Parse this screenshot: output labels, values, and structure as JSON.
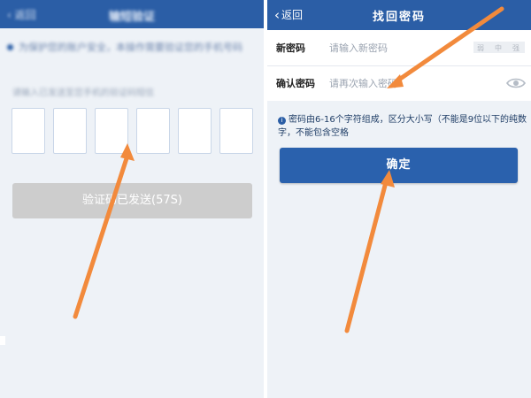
{
  "left": {
    "header": {
      "back": "返回",
      "title": "输短验证"
    },
    "notice": "为保护您的账户安全，本操作需要验证您的手机号码",
    "sub": "请输入已发送至您手机的验证码短信",
    "code_boxes": [
      "",
      "",
      "",
      "",
      "",
      ""
    ],
    "send_button": "验证码已发送(57S)"
  },
  "right": {
    "header": {
      "back_icon": "chevron-left-icon",
      "back": "返回",
      "title": "找回密码"
    },
    "new_password": {
      "label": "新密码",
      "placeholder": "请输入新密码",
      "strength": [
        "弱",
        "中",
        "强"
      ]
    },
    "confirm_password": {
      "label": "确认密码",
      "placeholder": "请再次输入密码",
      "eye_icon": "eye-icon"
    },
    "hint_icon": "info-icon",
    "hint": "密码由6-16个字符组成，区分大小写（不能是9位以下的纯数字，不能包含空格",
    "confirm_button": "确定"
  },
  "colors": {
    "brand": "#2b5ea6",
    "arrow": "#f28a3c",
    "disabled": "#cdcdcd"
  }
}
